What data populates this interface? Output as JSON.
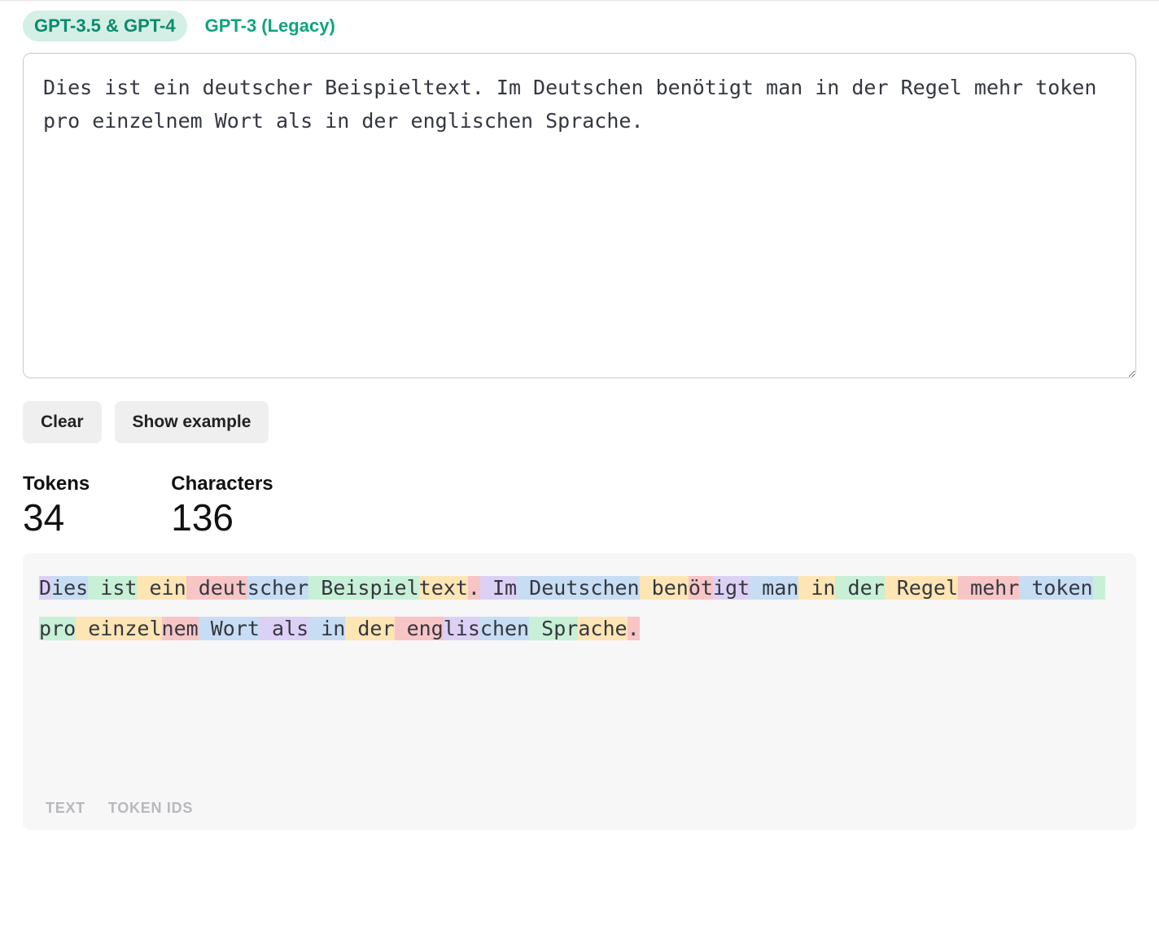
{
  "tabs": [
    {
      "label": "GPT-3.5 & GPT-4",
      "active": true
    },
    {
      "label": "GPT-3 (Legacy)",
      "active": false
    }
  ],
  "input": {
    "value": "Dies ist ein deutscher Beispieltext. Im Deutschen benötigt man in der Regel mehr token pro einzelnem Wort als in der englischen Sprache."
  },
  "buttons": {
    "clear": "Clear",
    "show_example": "Show example"
  },
  "stats": {
    "tokens_label": "Tokens",
    "tokens_value": "34",
    "characters_label": "Characters",
    "characters_value": "136"
  },
  "tokens": [
    {
      "text": "D",
      "c": 4
    },
    {
      "text": "ies",
      "c": 0
    },
    {
      "text": " ist",
      "c": 1
    },
    {
      "text": " ein",
      "c": 2
    },
    {
      "text": " deut",
      "c": 3
    },
    {
      "text": "scher",
      "c": 0
    },
    {
      "text": " Beispiel",
      "c": 1
    },
    {
      "text": "text",
      "c": 2
    },
    {
      "text": ".",
      "c": 3
    },
    {
      "text": " Im",
      "c": 4
    },
    {
      "text": " Deutschen",
      "c": 0
    },
    {
      "text": " ben",
      "c": 2
    },
    {
      "text": "öt",
      "c": 3
    },
    {
      "text": "igt",
      "c": 4
    },
    {
      "text": " man",
      "c": 0
    },
    {
      "text": " in",
      "c": 2
    },
    {
      "text": " der",
      "c": 1
    },
    {
      "text": " Regel",
      "c": 2
    },
    {
      "text": " mehr",
      "c": 3
    },
    {
      "text": " token",
      "c": 0
    },
    {
      "text": " pro",
      "c": 1
    },
    {
      "text": " einzel",
      "c": 2
    },
    {
      "text": "nem",
      "c": 3
    },
    {
      "text": " Wort",
      "c": 0
    },
    {
      "text": " als",
      "c": 4
    },
    {
      "text": " in",
      "c": 0
    },
    {
      "text": " der",
      "c": 2
    },
    {
      "text": " eng",
      "c": 3
    },
    {
      "text": "lis",
      "c": 4
    },
    {
      "text": "chen",
      "c": 0
    },
    {
      "text": " Spr",
      "c": 1
    },
    {
      "text": "ache",
      "c": 2
    },
    {
      "text": ".",
      "c": 3
    }
  ],
  "panel_tabs": {
    "text": "TEXT",
    "token_ids": "TOKEN IDS"
  }
}
